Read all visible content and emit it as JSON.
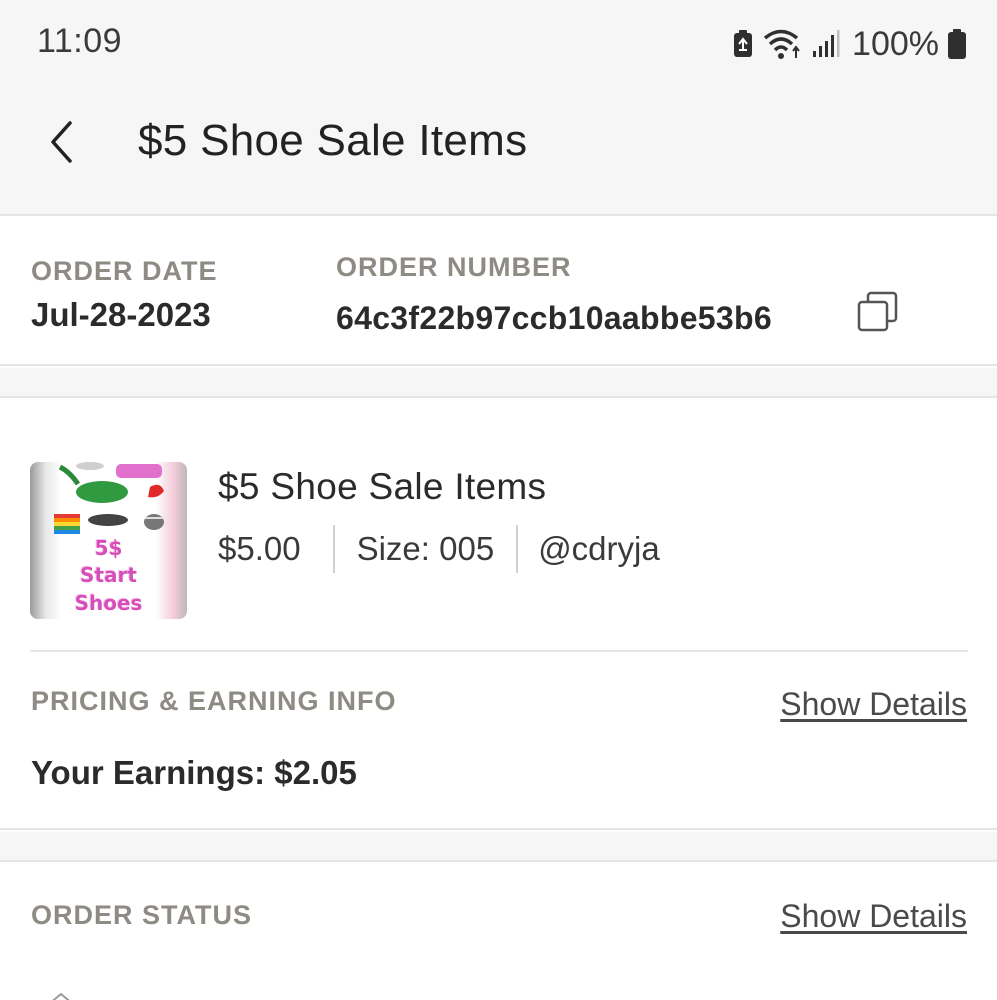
{
  "status_bar": {
    "time": "11:09",
    "battery_percent": "100%",
    "icons": [
      "battery-saver-icon",
      "wifi-icon",
      "signal-icon",
      "battery-icon"
    ]
  },
  "header": {
    "title": "$5 Shoe Sale Items",
    "back_icon": "chevron-left-icon"
  },
  "order": {
    "date_label": "ORDER DATE",
    "date_value": "Jul-28-2023",
    "number_label": "ORDER NUMBER",
    "number_value": "64c3f22b97ccb10aabbe53b6",
    "copy_icon": "copy-icon"
  },
  "item": {
    "title": "$5 Shoe Sale Items",
    "price": "$5.00",
    "size": "Size: 005",
    "seller": "@cdryja",
    "thumbnail_text": [
      "5$",
      "Start",
      "Shoes"
    ]
  },
  "pricing": {
    "label": "PRICING & EARNING INFO",
    "show_details": "Show Details",
    "earnings": "Your Earnings: $2.05"
  },
  "order_status": {
    "label": "ORDER STATUS",
    "show_details": "Show Details"
  },
  "colors": {
    "background_band": "#f6f6f6",
    "label_gray": "#8e8a84",
    "text_dark": "#2b2b2b",
    "thumbnail_pink": "#d64fb8"
  }
}
